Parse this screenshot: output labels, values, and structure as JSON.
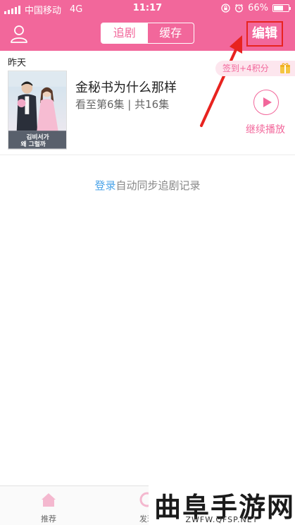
{
  "status_bar": {
    "carrier": "中国移动",
    "network": "4G",
    "time": "11:17",
    "battery": "66%",
    "battery_fraction": 0.66
  },
  "nav": {
    "tabs": [
      {
        "label": "追剧",
        "active": true
      },
      {
        "label": "缓存",
        "active": false
      }
    ],
    "edit_label": "编辑",
    "accent_color": "#f2679b"
  },
  "history": {
    "section_label": "昨天",
    "checkin_label": "签到+4积分",
    "item": {
      "title": "金秘书为什么那样",
      "progress": "看至第6集 | 共16集",
      "continue_label": "继续播放"
    }
  },
  "login_hint": {
    "link_label": "登录",
    "text": "自动同步追剧记录"
  },
  "tab_bar": {
    "items": [
      {
        "label": "推荐",
        "icon": "home-icon"
      },
      {
        "label": "发现",
        "icon": "discover-icon"
      }
    ]
  },
  "watermark": {
    "main": "曲阜手游网",
    "sub": "ZWFW.QFSP.NET"
  }
}
